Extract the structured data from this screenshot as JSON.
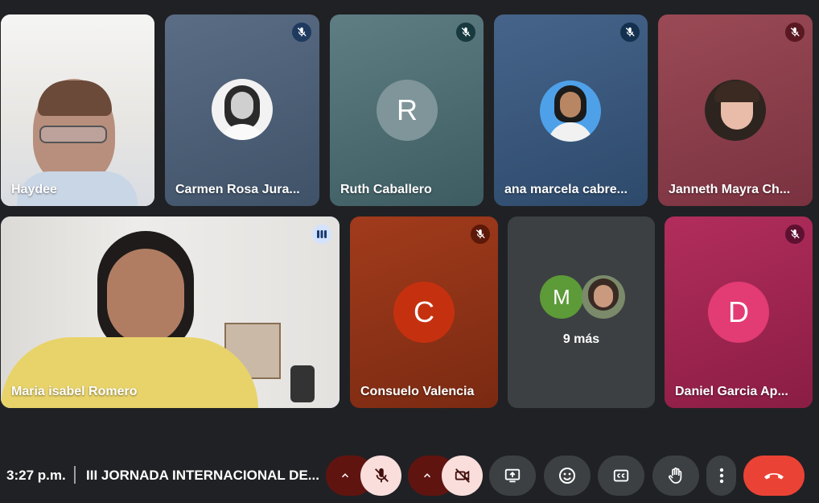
{
  "participants": [
    {
      "name": "Haydee",
      "type": "video"
    },
    {
      "name": "Carmen Rosa Jura...",
      "type": "photo-avatar",
      "muted": true
    },
    {
      "name": "Ruth Caballero",
      "type": "letter-avatar",
      "initial": "R",
      "muted": true
    },
    {
      "name": "ana marcela cabre...",
      "type": "photo-avatar",
      "muted": true
    },
    {
      "name": "Janneth Mayra Ch...",
      "type": "photo-avatar",
      "muted": true
    },
    {
      "name": "Maria isabel Romero",
      "type": "video",
      "speaking": true
    },
    {
      "name": "Consuelo Valencia",
      "type": "letter-avatar",
      "initial": "C",
      "muted": true
    },
    {
      "name": "Daniel Garcia Ap...",
      "type": "letter-avatar",
      "initial": "D",
      "muted": true
    }
  ],
  "overflow": {
    "initial": "M",
    "label": "9 más"
  },
  "footer": {
    "time": "3:27 p.m.",
    "meeting_title": "III JORNADA INTERNACIONAL DE..."
  },
  "controls": {
    "mic_muted": true,
    "camera_off": true
  },
  "colors": {
    "background": "#202124",
    "muted_control": "#f9dedc",
    "control_chevron": "#601410",
    "control_dark": "#3c4043",
    "leave": "#ea4335",
    "speaking_border": "#a8c7fa"
  },
  "icons": [
    "mic-off-icon",
    "camera-off-icon",
    "present-icon",
    "emoji-icon",
    "captions-icon",
    "raise-hand-icon",
    "more-icon",
    "leave-call-icon",
    "chevron-up-icon",
    "audio-level-icon"
  ]
}
